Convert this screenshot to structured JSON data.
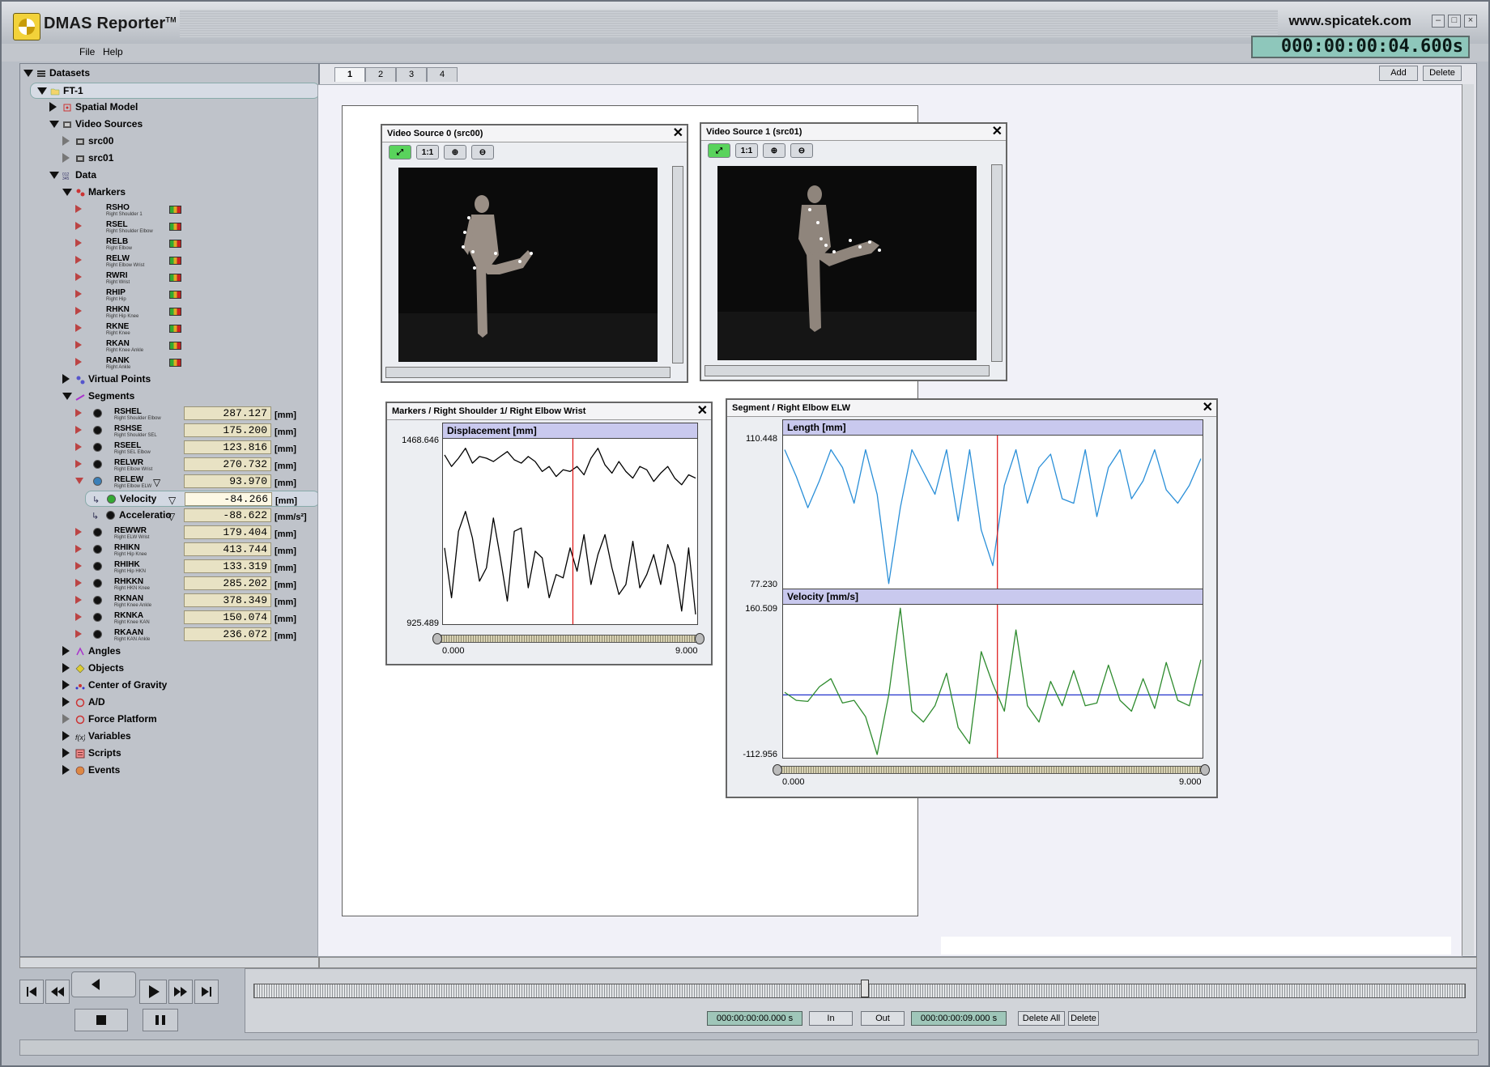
{
  "app": {
    "title": "DMAS Reporter",
    "trademark": "TM",
    "site": "www.spicatek.com",
    "clock": "000:00:00:04.600s"
  },
  "menu": {
    "file": "File",
    "help": "Help"
  },
  "tree": {
    "root": "Datasets",
    "dataset": "FT-1",
    "spatial_model": "Spatial Model",
    "video_sources": "Video Sources",
    "src0": "src00",
    "src1": "src01",
    "data": "Data",
    "markers": "Markers",
    "marker_items": [
      {
        "code": "RSHO",
        "desc": "Right Shoulder 1"
      },
      {
        "code": "RSEL",
        "desc": "Right Shoulder Elbow"
      },
      {
        "code": "RELB",
        "desc": "Right Elbow"
      },
      {
        "code": "RELW",
        "desc": "Right Elbow Wrist"
      },
      {
        "code": "RWRI",
        "desc": "Right Wrist"
      },
      {
        "code": "RHIP",
        "desc": "Right Hip"
      },
      {
        "code": "RHKN",
        "desc": "Right Hip Knee"
      },
      {
        "code": "RKNE",
        "desc": "Right Knee"
      },
      {
        "code": "RKAN",
        "desc": "Right Knee Ankle"
      },
      {
        "code": "RANK",
        "desc": "Right Ankle"
      }
    ],
    "virtual_points": "Virtual Points",
    "segments": "Segments",
    "segment_items": [
      {
        "code": "RSHEL",
        "desc": "Right Shoulder Elbow",
        "value": "287.127",
        "unit": "[mm]"
      },
      {
        "code": "RSHSE",
        "desc": "Right Shoulder SEL",
        "value": "175.200",
        "unit": "[mm]"
      },
      {
        "code": "RSEEL",
        "desc": "Right SEL Elbow",
        "value": "123.816",
        "unit": "[mm]"
      },
      {
        "code": "RELWR",
        "desc": "Right Elbow Wrist",
        "value": "270.732",
        "unit": "[mm]"
      },
      {
        "code": "RELEW",
        "desc": "Right Elbow ELW",
        "value": "93.970",
        "unit": "[mm]"
      }
    ],
    "velocity": {
      "label": "Velocity",
      "value": "-84.266",
      "unit": "[mm]"
    },
    "acceleration": {
      "label": "Acceleratio",
      "value": "-88.622",
      "unit": "[mm/s²]"
    },
    "segment_items_2": [
      {
        "code": "REWWR",
        "desc": "Right ELW Wrist",
        "value": "179.404",
        "unit": "[mm]"
      },
      {
        "code": "RHIKN",
        "desc": "Right Hip Knee",
        "value": "413.744",
        "unit": "[mm]"
      },
      {
        "code": "RHIHK",
        "desc": "Right Hip HKN",
        "value": "133.319",
        "unit": "[mm]"
      },
      {
        "code": "RHKKN",
        "desc": "Right HKN Knee",
        "value": "285.202",
        "unit": "[mm]"
      },
      {
        "code": "RKNAN",
        "desc": "Right Knee Ankle",
        "value": "378.349",
        "unit": "[mm]"
      },
      {
        "code": "RKNKA",
        "desc": "Right Knee KAN",
        "value": "150.074",
        "unit": "[mm]"
      },
      {
        "code": "RKAAN",
        "desc": "Right KAN Ankle",
        "value": "236.072",
        "unit": "[mm]"
      }
    ],
    "angles": "Angles",
    "objects": "Objects",
    "cog": "Center of Gravity",
    "ad": "A/D",
    "force": "Force Platform",
    "variables": "Variables",
    "scripts": "Scripts",
    "events": "Events"
  },
  "tabs": [
    "1",
    "2",
    "3",
    "4"
  ],
  "header_buttons": {
    "add": "Add",
    "delete": "Delete"
  },
  "video0": {
    "title": "Video Source 0 (src00)",
    "one_to_one": "1:1"
  },
  "video1": {
    "title": "Video Source 1 (src01)",
    "one_to_one": "1:1"
  },
  "chart_panel1": {
    "title": "Markers / Right Shoulder 1/ Right Elbow Wrist"
  },
  "chart_panel2": {
    "title": "Segment / Right Elbow ELW"
  },
  "chart_data": [
    {
      "type": "line",
      "header": "Displacement   [mm]",
      "ylim": [
        925.489,
        1468.646
      ],
      "xlim": [
        0.0,
        9.0
      ],
      "y_top_label": "1468.646",
      "y_bottom_label": "925.489",
      "x_start_label": "0.000",
      "x_end_label": "9.000",
      "cursor_x": 4.6,
      "series": [
        {
          "color": "#000000",
          "x": [
            0,
            0.25,
            0.5,
            0.75,
            1.0,
            1.25,
            1.5,
            1.75,
            2.0,
            2.25,
            2.5,
            2.75,
            3.0,
            3.25,
            3.5,
            3.75,
            4.0,
            4.25,
            4.5,
            4.75,
            5.0,
            5.25,
            5.5,
            5.75,
            6.0,
            6.25,
            6.5,
            6.75,
            7.0,
            7.25,
            7.5,
            7.75,
            8.0,
            8.25,
            8.5,
            8.75,
            9.0
          ],
          "y": [
            1430,
            1395,
            1420,
            1450,
            1405,
            1425,
            1420,
            1410,
            1425,
            1440,
            1415,
            1405,
            1425,
            1410,
            1380,
            1395,
            1365,
            1385,
            1380,
            1395,
            1370,
            1420,
            1450,
            1400,
            1375,
            1410,
            1380,
            1360,
            1395,
            1385,
            1350,
            1375,
            1395,
            1360,
            1340,
            1370,
            1360
          ]
        },
        {
          "color": "#000000",
          "x": [
            0,
            0.25,
            0.5,
            0.75,
            1.0,
            1.25,
            1.5,
            1.75,
            2.0,
            2.25,
            2.5,
            2.75,
            3.0,
            3.25,
            3.5,
            3.75,
            4.0,
            4.25,
            4.5,
            4.75,
            5.0,
            5.25,
            5.5,
            5.75,
            6.0,
            6.25,
            6.5,
            6.75,
            7.0,
            7.25,
            7.5,
            7.75,
            8.0,
            8.25,
            8.5,
            8.75,
            9.0
          ],
          "y": [
            1150,
            1000,
            1200,
            1260,
            1180,
            1050,
            1090,
            1240,
            1120,
            990,
            1200,
            1210,
            1030,
            1140,
            1120,
            1000,
            1070,
            1060,
            1150,
            1080,
            1190,
            1040,
            1130,
            1190,
            1090,
            1010,
            1040,
            1170,
            1030,
            1070,
            1130,
            1040,
            1160,
            1100,
            960,
            1150,
            950
          ]
        }
      ]
    },
    {
      "type": "line",
      "header": "Length   [mm]",
      "ylim": [
        77.23,
        110.448
      ],
      "xlim": [
        0.0,
        9.0
      ],
      "y_top_label": "110.448",
      "y_bottom_label": "77.230",
      "cursor_x": 4.6,
      "series": [
        {
          "color": "#2a8fd8",
          "x": [
            0,
            0.25,
            0.5,
            0.75,
            1.0,
            1.25,
            1.5,
            1.75,
            2.0,
            2.25,
            2.5,
            2.75,
            3.0,
            3.25,
            3.5,
            3.75,
            4.0,
            4.25,
            4.5,
            4.75,
            5.0,
            5.25,
            5.5,
            5.75,
            6.0,
            6.25,
            6.5,
            6.75,
            7.0,
            7.25,
            7.5,
            7.75,
            8.0,
            8.25,
            8.5,
            8.75,
            9.0
          ],
          "y": [
            108,
            102,
            95,
            101,
            108,
            104,
            96,
            108,
            98,
            78,
            95,
            108,
            103,
            98,
            108,
            92,
            108,
            90,
            82,
            100,
            108,
            96,
            104,
            107,
            97,
            96,
            108,
            93,
            104,
            108,
            97,
            101,
            108,
            99,
            96,
            100,
            106
          ]
        }
      ]
    },
    {
      "type": "line",
      "header": "Velocity   [mm/s]",
      "ylim": [
        -112.956,
        160.509
      ],
      "xlim": [
        0.0,
        9.0
      ],
      "y_top_label": "160.509",
      "y_bottom_label": "-112.956",
      "x_start_label": "0.000",
      "x_end_label": "9.000",
      "cursor_x": 4.6,
      "zero_line": 0,
      "series": [
        {
          "color": "#2e8b2e",
          "x": [
            0,
            0.25,
            0.5,
            0.75,
            1.0,
            1.25,
            1.5,
            1.75,
            2.0,
            2.25,
            2.5,
            2.75,
            3.0,
            3.25,
            3.5,
            3.75,
            4.0,
            4.25,
            4.5,
            4.75,
            5.0,
            5.25,
            5.5,
            5.75,
            6.0,
            6.25,
            6.5,
            6.75,
            7.0,
            7.25,
            7.5,
            7.75,
            8.0,
            8.25,
            8.5,
            8.75,
            9.0
          ],
          "y": [
            5,
            -10,
            -12,
            15,
            30,
            -15,
            -10,
            -40,
            -110,
            0,
            160,
            -30,
            -50,
            -20,
            40,
            -60,
            -90,
            80,
            20,
            -30,
            120,
            -20,
            -50,
            25,
            -20,
            45,
            -20,
            -15,
            55,
            -10,
            -30,
            30,
            -25,
            60,
            -10,
            -20,
            65
          ]
        }
      ]
    }
  ],
  "timeline": {
    "start": "000:00:00:00.000 s",
    "in": "In",
    "out": "Out",
    "end": "000:00:00:09.000 s",
    "delete_all": "Delete All",
    "delete": "Delete"
  }
}
